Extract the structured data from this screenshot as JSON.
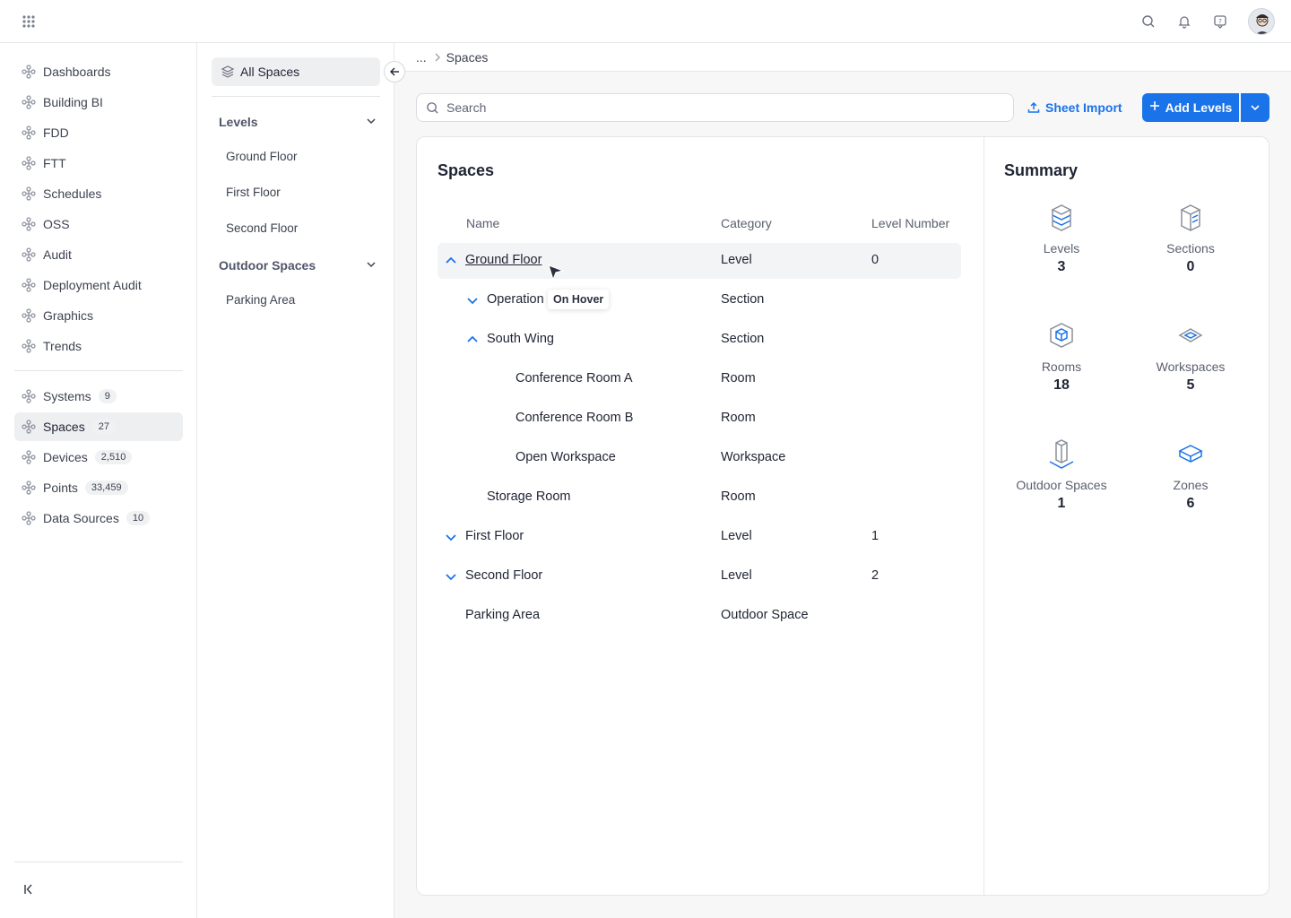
{
  "sidebar": {
    "items": [
      {
        "label": "Dashboards"
      },
      {
        "label": "Building BI"
      },
      {
        "label": "FDD"
      },
      {
        "label": "FTT"
      },
      {
        "label": "Schedules"
      },
      {
        "label": "OSS"
      },
      {
        "label": "Audit"
      },
      {
        "label": "Deployment Audit"
      },
      {
        "label": "Graphics"
      },
      {
        "label": "Trends"
      }
    ],
    "counted_items": [
      {
        "label": "Systems",
        "count": "9"
      },
      {
        "label": "Spaces",
        "count": "27"
      },
      {
        "label": "Devices",
        "count": "2,510"
      },
      {
        "label": "Points",
        "count": "33,459"
      },
      {
        "label": "Data Sources",
        "count": "10"
      }
    ]
  },
  "panel": {
    "all_spaces": "All Spaces",
    "groups": [
      {
        "label": "Levels",
        "items": [
          "Ground Floor",
          "First Floor",
          "Second Floor"
        ]
      },
      {
        "label": "Outdoor Spaces",
        "items": [
          "Parking Area"
        ]
      }
    ]
  },
  "breadcrumb": {
    "ellipsis": "...",
    "current": "Spaces"
  },
  "toolbar": {
    "search_placeholder": "Search",
    "sheet_import": "Sheet Import",
    "add_levels": "Add Levels"
  },
  "spaces": {
    "title": "Spaces",
    "columns": [
      "Name",
      "Category",
      "Level Number"
    ],
    "rows": [
      {
        "name": "Ground Floor",
        "category": "Level",
        "level": "0"
      },
      {
        "name": "Operation",
        "category": "Section",
        "level": ""
      },
      {
        "name": "South Wing",
        "category": "Section",
        "level": ""
      },
      {
        "name": "Conference Room A",
        "category": "Room",
        "level": ""
      },
      {
        "name": "Conference Room B",
        "category": "Room",
        "level": ""
      },
      {
        "name": "Open Workspace",
        "category": "Workspace",
        "level": ""
      },
      {
        "name": "Storage Room",
        "category": "Room",
        "level": ""
      },
      {
        "name": "First Floor",
        "category": "Level",
        "level": "1"
      },
      {
        "name": "Second Floor",
        "category": "Level",
        "level": "2"
      },
      {
        "name": "Parking Area",
        "category": "Outdoor Space",
        "level": ""
      }
    ],
    "tooltip": "On Hover"
  },
  "summary": {
    "title": "Summary",
    "stats": [
      {
        "label": "Levels",
        "value": "3",
        "icon": "levels-icon"
      },
      {
        "label": "Sections",
        "value": "0",
        "icon": "sections-icon"
      },
      {
        "label": "Rooms",
        "value": "18",
        "icon": "rooms-icon"
      },
      {
        "label": "Workspaces",
        "value": "5",
        "icon": "workspaces-icon"
      },
      {
        "label": "Outdoor Spaces",
        "value": "1",
        "icon": "outdoor-spaces-icon"
      },
      {
        "label": "Zones",
        "value": "6",
        "icon": "zones-icon"
      }
    ]
  },
  "colors": {
    "accent": "#1a73e8",
    "active_bg": "#eeeff1"
  }
}
